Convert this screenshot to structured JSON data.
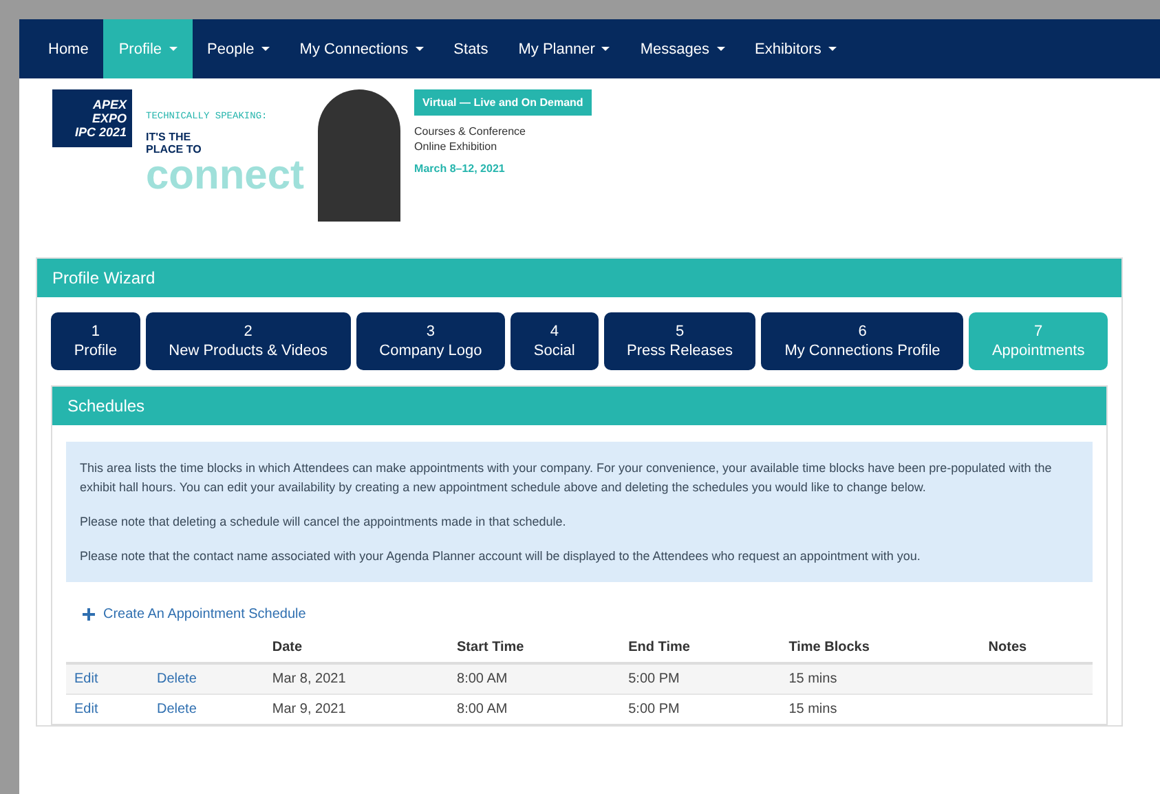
{
  "nav": [
    {
      "label": "Home",
      "selected": false,
      "dropdown": false
    },
    {
      "label": "Profile",
      "selected": true,
      "dropdown": true
    },
    {
      "label": "People",
      "selected": false,
      "dropdown": true
    },
    {
      "label": "My Connections",
      "selected": false,
      "dropdown": true
    },
    {
      "label": "Stats",
      "selected": false,
      "dropdown": false
    },
    {
      "label": "My Planner",
      "selected": false,
      "dropdown": true
    },
    {
      "label": "Messages",
      "selected": false,
      "dropdown": true
    },
    {
      "label": "Exhibitors",
      "selected": false,
      "dropdown": true
    }
  ],
  "banner": {
    "logo_lines": [
      "APEX",
      "EXPO",
      "IPC 2021"
    ],
    "tagline_top": "TECHNICALLY SPEAKING:",
    "tagline_mid": "IT'S THE PLACE TO",
    "tagline_big": "connect",
    "badge": "Virtual — Live and On Demand",
    "details": [
      "Courses & Conference",
      "Online Exhibition"
    ],
    "dates": "March 8–12, 2021"
  },
  "wizard": {
    "title": "Profile Wizard",
    "steps": [
      {
        "number": "1",
        "label": "Profile",
        "selected": false
      },
      {
        "number": "2",
        "label": "New Products & Videos",
        "selected": false
      },
      {
        "number": "3",
        "label": "Company Logo",
        "selected": false
      },
      {
        "number": "4",
        "label": "Social",
        "selected": false
      },
      {
        "number": "5",
        "label": "Press Releases",
        "selected": false
      },
      {
        "number": "6",
        "label": "My Connections Profile",
        "selected": false
      },
      {
        "number": "7",
        "label": "Appointments",
        "selected": true
      }
    ]
  },
  "schedules": {
    "title": "Schedules",
    "info": [
      "This area lists the time blocks in which Attendees can make appointments with your company. For your convenience, your available time blocks have been pre-populated with the exhibit hall hours. You can edit your availability by creating a new appointment schedule above and deleting the schedules you would like to change below.",
      "Please note that deleting a schedule will cancel the appointments made in that schedule.",
      "Please note that the contact name associated with your Agenda Planner account will be displayed to the Attendees who request an appointment with you."
    ],
    "create_link": "Create An Appointment Schedule",
    "columns": [
      "Date",
      "Start Time",
      "End Time",
      "Time Blocks",
      "Notes"
    ],
    "rows": [
      {
        "edit": "Edit",
        "delete": "Delete",
        "date": "Mar 8, 2021",
        "start": "8:00 AM",
        "end": "5:00 PM",
        "blocks": "15 mins"
      },
      {
        "edit": "Edit",
        "delete": "Delete",
        "date": "Mar 9, 2021",
        "start": "8:00 AM",
        "end": "5:00 PM",
        "blocks": "15 mins"
      }
    ]
  }
}
